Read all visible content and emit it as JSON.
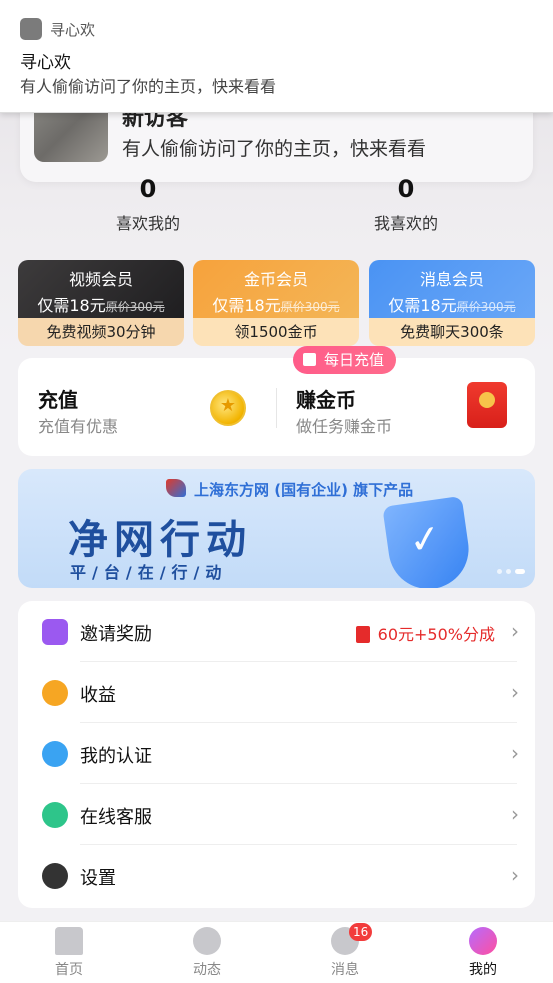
{
  "notification": {
    "app_name": "寻心欢",
    "title": "寻心欢",
    "body": "有人偷偷访问了你的主页，快来看看"
  },
  "visitor": {
    "title": "新访客",
    "desc": "有人偷偷访问了你的主页，快来看看"
  },
  "stats": [
    {
      "num": "0",
      "label": "喜欢我的"
    },
    {
      "num": "0",
      "label": "我喜欢的"
    }
  ],
  "members": [
    {
      "title": "视频会员",
      "price": "仅需18元",
      "orig": "原价300元",
      "benefit": "免费视频30分钟"
    },
    {
      "title": "金币会员",
      "price": "仅需18元",
      "orig": "原价300元",
      "benefit": "领1500金币"
    },
    {
      "title": "消息会员",
      "price": "仅需18元",
      "orig": "原价300元",
      "benefit": "免费聊天300条"
    }
  ],
  "recharge": {
    "title": "充值",
    "sub": "充值有优惠",
    "earn_title": "赚金币",
    "earn_sub": "做任务赚金币",
    "daily_badge": "每日充值"
  },
  "banner": {
    "org": "上海东方网 (国有企业) 旗下产品",
    "title": "净网行动",
    "sub": "平/台/在/行/动"
  },
  "menu": [
    {
      "label": "邀请奖励",
      "extra": "60元+50%分成",
      "icon": "gift-icon",
      "color": "#9b59f0"
    },
    {
      "label": "收益",
      "extra": "",
      "icon": "piggy-bank-icon",
      "color": "#f6a623"
    },
    {
      "label": "我的认证",
      "extra": "",
      "icon": "verified-badge-icon",
      "color": "#3aa3f2"
    },
    {
      "label": "在线客服",
      "extra": "",
      "icon": "customer-service-icon",
      "color": "#2ec58a"
    },
    {
      "label": "设置",
      "extra": "",
      "icon": "gear-icon",
      "color": "#333333"
    }
  ],
  "nav": [
    {
      "label": "首页",
      "icon": "home-icon"
    },
    {
      "label": "动态",
      "icon": "moments-icon"
    },
    {
      "label": "消息",
      "icon": "message-icon",
      "badge": "16"
    },
    {
      "label": "我的",
      "icon": "profile-icon"
    }
  ]
}
